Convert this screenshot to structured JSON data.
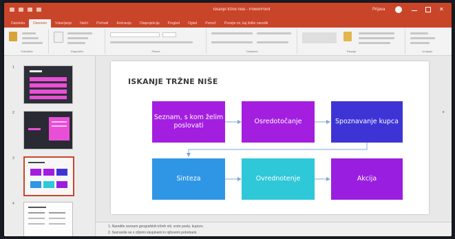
{
  "window": {
    "title": "Iskanje tržne niše - PowerPoint",
    "account": "Prijava"
  },
  "tabs": [
    "Datoteka",
    "Osnovno",
    "Vstavljanje",
    "Načrt",
    "Prehodi",
    "Animacije",
    "Diaprojekcija",
    "Pregled",
    "Ogled",
    "Pomoč",
    "Povejte mi, kaj želite narediti"
  ],
  "active_tab": "Osnovno",
  "ribbon_groups": [
    "Odložišče",
    "Diapozitivi",
    "Pisava",
    "Odstavek",
    "Risanje",
    "Urejanje"
  ],
  "thumbnails": [
    {
      "num": "1"
    },
    {
      "num": "2"
    },
    {
      "num": "3"
    },
    {
      "num": "4"
    }
  ],
  "slide": {
    "title": "ISKANJE TRŽNE NIŠE",
    "boxes": [
      {
        "label": "Seznam, s kom želim poslovati",
        "color": "#a41ee0"
      },
      {
        "label": "Osredotočanje",
        "color": "#a41ee0"
      },
      {
        "label": "Spoznavanje kupca",
        "color": "#3e34d6"
      },
      {
        "label": "Sinteza",
        "color": "#2f96e6"
      },
      {
        "label": "Ovrednotenje",
        "color": "#2ec8d8"
      },
      {
        "label": "Akcija",
        "color": "#9a1edf"
      }
    ]
  },
  "notes": [
    "1.  Naredite seznam geografskih tržnih niš, vrste posla, kupcev.",
    "2.  Seznanite se s ciljnimi skupinami in njihovimi potrebami."
  ]
}
